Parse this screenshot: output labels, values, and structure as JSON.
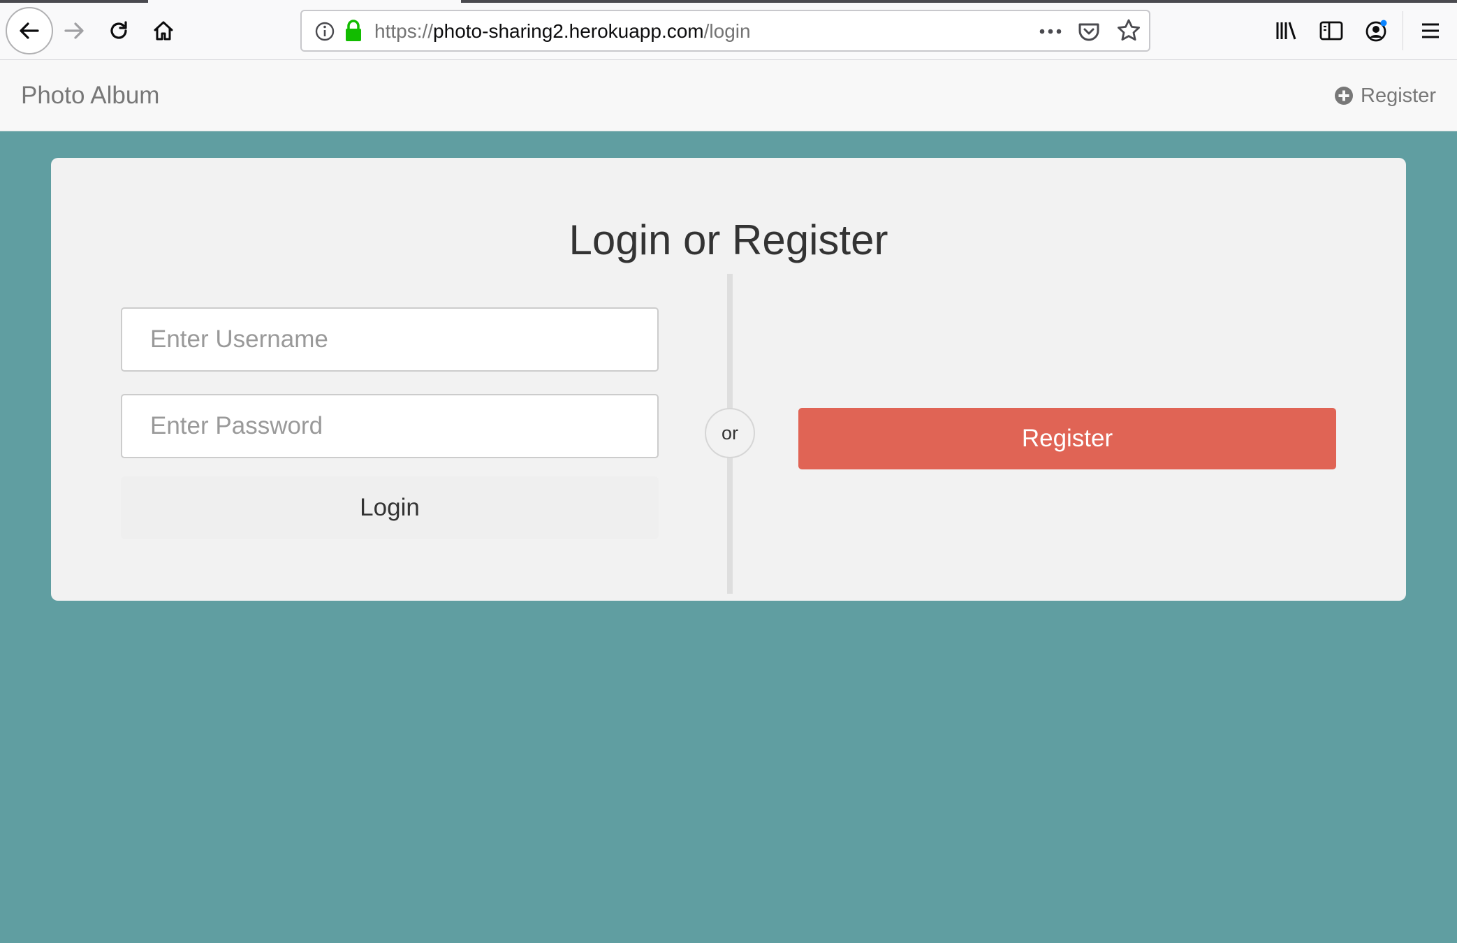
{
  "browser": {
    "url_scheme": "https://",
    "url_host": "photo-sharing2.herokuapp.com",
    "url_path": "/login"
  },
  "navbar": {
    "brand": "Photo Album",
    "register_label": "Register"
  },
  "card": {
    "title": "Login or Register",
    "username_placeholder": "Enter Username",
    "password_placeholder": "Enter Password",
    "login_label": "Login",
    "or_label": "or",
    "register_label": "Register"
  },
  "colors": {
    "page_background": "#609ea1",
    "register_button": "#e06455",
    "lock_green": "#12bc00"
  }
}
